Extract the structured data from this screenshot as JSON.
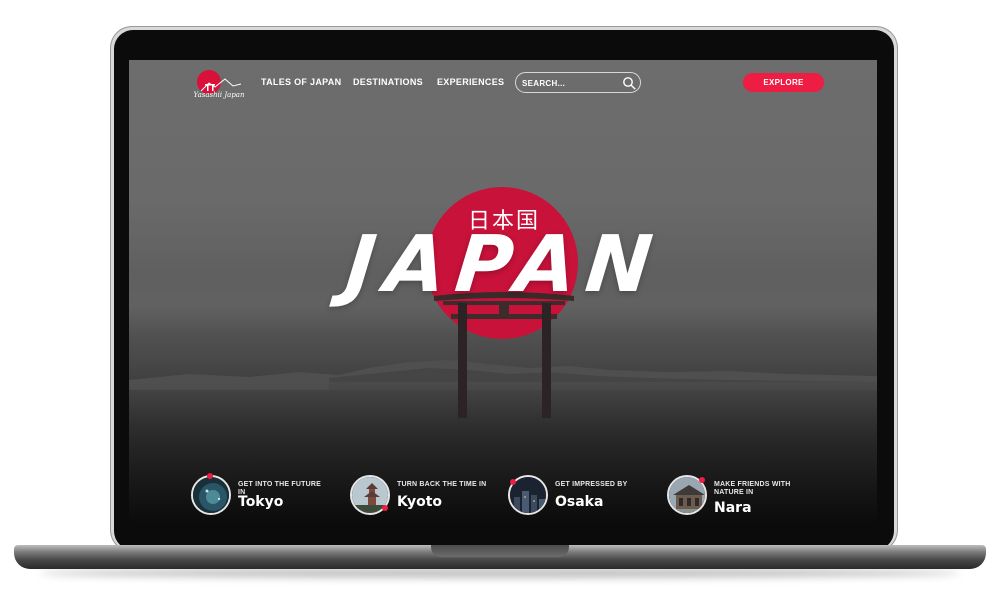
{
  "brand": {
    "logo_text": "Yasashii Japan",
    "accent_color": "#ed1d43",
    "sun_color": "#c8123a"
  },
  "nav": {
    "links": [
      "TALES OF JAPAN",
      "DESTINATIONS",
      "EXPERIENCES"
    ],
    "search_placeholder": "SEARCH...",
    "search_icon": "search-icon",
    "explore_label": "EXPLORE"
  },
  "hero": {
    "kanji": "日本国",
    "title": "JAPAN"
  },
  "destinations": [
    {
      "subtitle": "GET INTO THE FUTURE IN",
      "name": "Tokyo"
    },
    {
      "subtitle": "TURN BACK THE TIME IN",
      "name": "Kyoto"
    },
    {
      "subtitle": "GET IMPRESSED BY",
      "name": "Osaka"
    },
    {
      "subtitle": "MAKE FRIENDS WITH NATURE IN",
      "name": "Nara"
    }
  ]
}
